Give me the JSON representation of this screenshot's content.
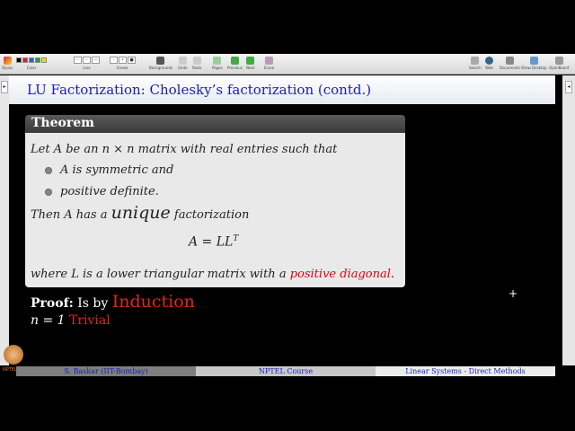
{
  "toolbar": {
    "stylus": "Stylus",
    "color": "Color",
    "line": "Line",
    "eraser": "Eraser",
    "backgrounds": "Backgrounds",
    "undo": "Undo",
    "redo": "Redo",
    "pages": "Pages",
    "previous": "Previous",
    "next": "Next",
    "erase": "Erase",
    "search": "Search",
    "web": "Web",
    "documents": "Documents",
    "show_desktop": "Show Desktop",
    "openboard": "OpenBoard",
    "swatch_colors": [
      "#000000",
      "#e02020",
      "#2060e0",
      "#20a020",
      "#e0e020"
    ]
  },
  "slide": {
    "title": "LU Factorization: Cholesky’s factorization (contd.)",
    "theorem_heading": "Theorem",
    "line1": "Let A be an n × n matrix with real entries such that",
    "bullet1": "A is symmetric and",
    "bullet2": "positive definite.",
    "line2_a": "Then A has a ",
    "line2_unique": "unique",
    "line2_b": " factorization",
    "equation": "A = LL",
    "equation_sup": "T",
    "line3_a": "where L is a lower triangular matrix with a ",
    "line3_pos": "positive diagonal",
    "line3_b": ".",
    "proof_label": "Proof:",
    "proof_text": " Is by ",
    "proof_induction": "Induction",
    "n1_text": "n = 1 ",
    "n1_trivial": "Trivial"
  },
  "footer": {
    "left": "S. Baskar   (IIT-Bombay)",
    "middle": "NPTEL Course",
    "right": "Linear Systems - Direct Methods",
    "logo_text": "NPTEL"
  }
}
